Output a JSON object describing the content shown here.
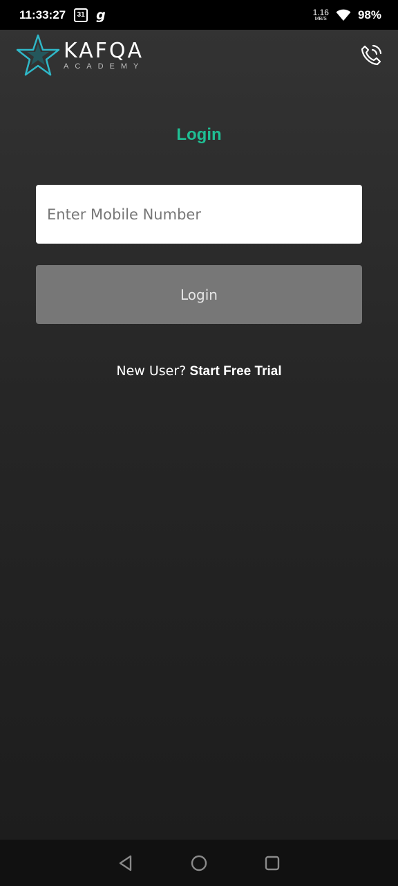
{
  "status_bar": {
    "time": "11:33:27",
    "calendar_day": "31",
    "app_glyph": "g",
    "net_speed_value": "1.16",
    "net_speed_unit": "MB/S",
    "battery": "98%"
  },
  "header": {
    "brand": "KAFQA",
    "tagline": "ACADEMY",
    "icons": {
      "logo": "star-logo-icon",
      "call": "phone-call-icon"
    }
  },
  "login": {
    "title": "Login",
    "mobile_placeholder": "Enter Mobile Number",
    "mobile_value": "",
    "button_label": "Login",
    "new_user_text": "New User?",
    "trial_link": "Start Free Trial"
  },
  "colors": {
    "accent": "#1fbf94",
    "button_disabled": "#777777",
    "logo_teal": "#2fb8c8"
  },
  "nav": {
    "icons": [
      "back-icon",
      "home-icon",
      "recents-icon"
    ]
  }
}
